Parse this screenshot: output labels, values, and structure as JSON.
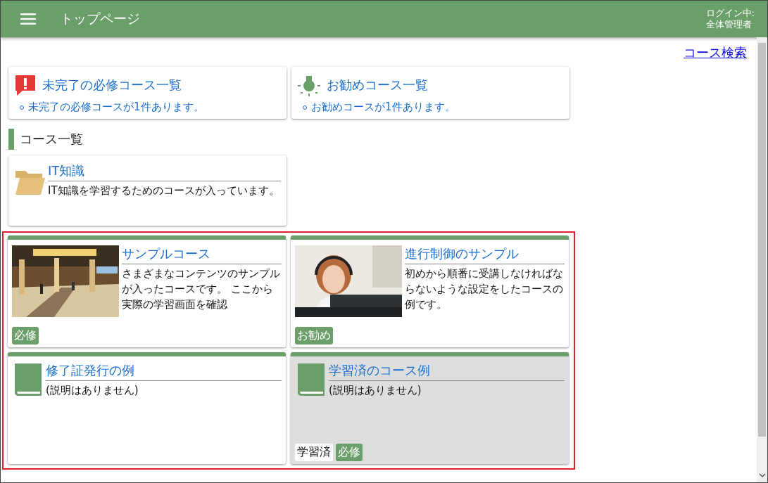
{
  "header": {
    "title": "トップページ",
    "login_label": "ログイン中:",
    "user": "全体管理者"
  },
  "search_link": "コース検索",
  "summary_cards": [
    {
      "kind": "alert",
      "title": "未完了の必修コース一覧",
      "item": "未完了の必修コースが1件あります。"
    },
    {
      "kind": "bulb",
      "title": "お勧めコース一覧",
      "item": "お勧めコースが1件あります。"
    }
  ],
  "section_title": "コース一覧",
  "folders": [
    {
      "title": "IT知識",
      "description": "IT知識を学習するためのコースが入っています。"
    }
  ],
  "courses": [
    {
      "title": "サンプルコース",
      "description": "さまざまなコンテンツのサンプルが入ったコースです。 ここから実際の学習画面を確認",
      "completed": false,
      "badges": [
        {
          "kind": "tag",
          "label": "必修"
        }
      ]
    },
    {
      "title": "進行制御のサンプル",
      "description": "初めから順番に受講しなければならないような設定をしたコースの例です。",
      "completed": false,
      "badges": [
        {
          "kind": "tag",
          "label": "お勧め"
        }
      ]
    },
    {
      "kind": "book",
      "title": "修了証発行の例",
      "description": "(説明はありません)",
      "completed": false
    },
    {
      "kind": "book",
      "title": "学習済のコース例",
      "description": "(説明はありません)",
      "completed": true,
      "badges": [
        {
          "kind": "status",
          "label": "学習済"
        },
        {
          "kind": "tag",
          "label": "必修"
        }
      ]
    }
  ]
}
